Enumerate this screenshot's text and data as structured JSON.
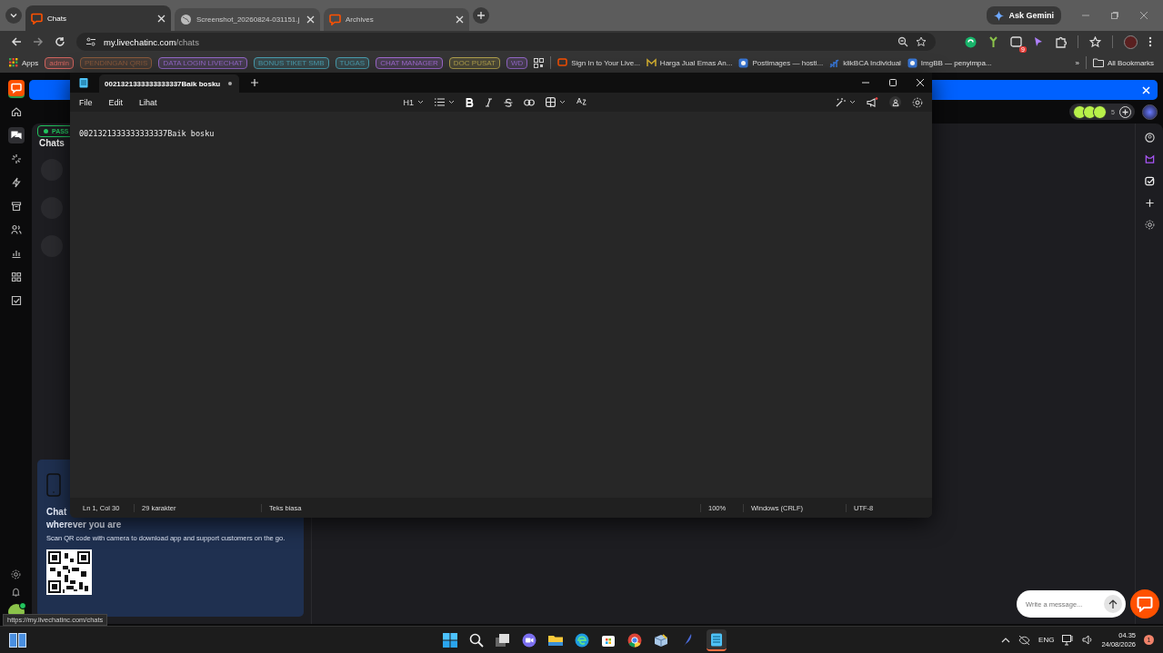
{
  "browser": {
    "tabs": [
      {
        "title": "Chats",
        "selected": true
      },
      {
        "title": "Screenshot_20260824-031151.j",
        "selected": false
      },
      {
        "title": "Archives",
        "selected": false
      }
    ],
    "ask_button": "Ask Gemini",
    "url": {
      "host": "my.livechatinc.com",
      "path": "/chats"
    },
    "extension_badge": "9",
    "apps_label": "Apps",
    "tag_bookmarks": [
      {
        "label": "admin",
        "color": "#d0645e"
      },
      {
        "label": "PENDINGAN QRIS",
        "color": "#8a5a3c"
      },
      {
        "label": "DATA LOGIN LIVECHAT",
        "color": "#9468c8"
      },
      {
        "label": "BONUS TIKET SMB",
        "color": "#4a9eb0"
      },
      {
        "label": "TUGAS",
        "color": "#4a9eb0"
      },
      {
        "label": "CHAT MANAGER",
        "color": "#a06ad0"
      },
      {
        "label": "DOC PUSAT",
        "color": "#b0a04c"
      },
      {
        "label": "WD",
        "color": "#9468c8"
      }
    ],
    "link_bookmarks": [
      {
        "label": "Sign In to Your Live..."
      },
      {
        "label": "Harga Jual Emas An..."
      },
      {
        "label": "Postimages — hosti..."
      },
      {
        "label": "klikBCA Individual"
      },
      {
        "label": "ImgBB — penyimpa..."
      }
    ],
    "more": "»",
    "all_bookmarks": "All Bookmarks",
    "status_link": "https://my.livechatinc.com/chats"
  },
  "livechat": {
    "nav": [
      {
        "selected": false
      },
      {
        "selected": true
      },
      {
        "selected": false
      },
      {
        "selected": false
      },
      {
        "selected": false
      },
      {
        "selected": false
      },
      {
        "selected": false
      },
      {
        "selected": false
      },
      {
        "selected": false
      }
    ],
    "agent_count": "5",
    "badge": "PASS",
    "list_title": "Chats",
    "promo": {
      "title_lines": [
        "Chat",
        "wherever you are"
      ],
      "text": "Scan QR code with camera to download app and support customers on the go."
    },
    "message_placeholder": "Write a message..."
  },
  "notepad": {
    "tab_title": "0021321333333333337Baik bosku",
    "unsaved": true,
    "menus": [
      "File",
      "Edit",
      "Lihat"
    ],
    "heading": "H1",
    "content": "0021321333333333337Baik bosku",
    "status": [
      "Ln 1, Col 30",
      "29 karakter",
      "Teks biasa",
      "100%",
      "Windows (CRLF)",
      "UTF-8"
    ]
  },
  "taskbar": {
    "language": "ENG",
    "time": "04.35",
    "date": "24/08/2026",
    "notifications": "1"
  }
}
